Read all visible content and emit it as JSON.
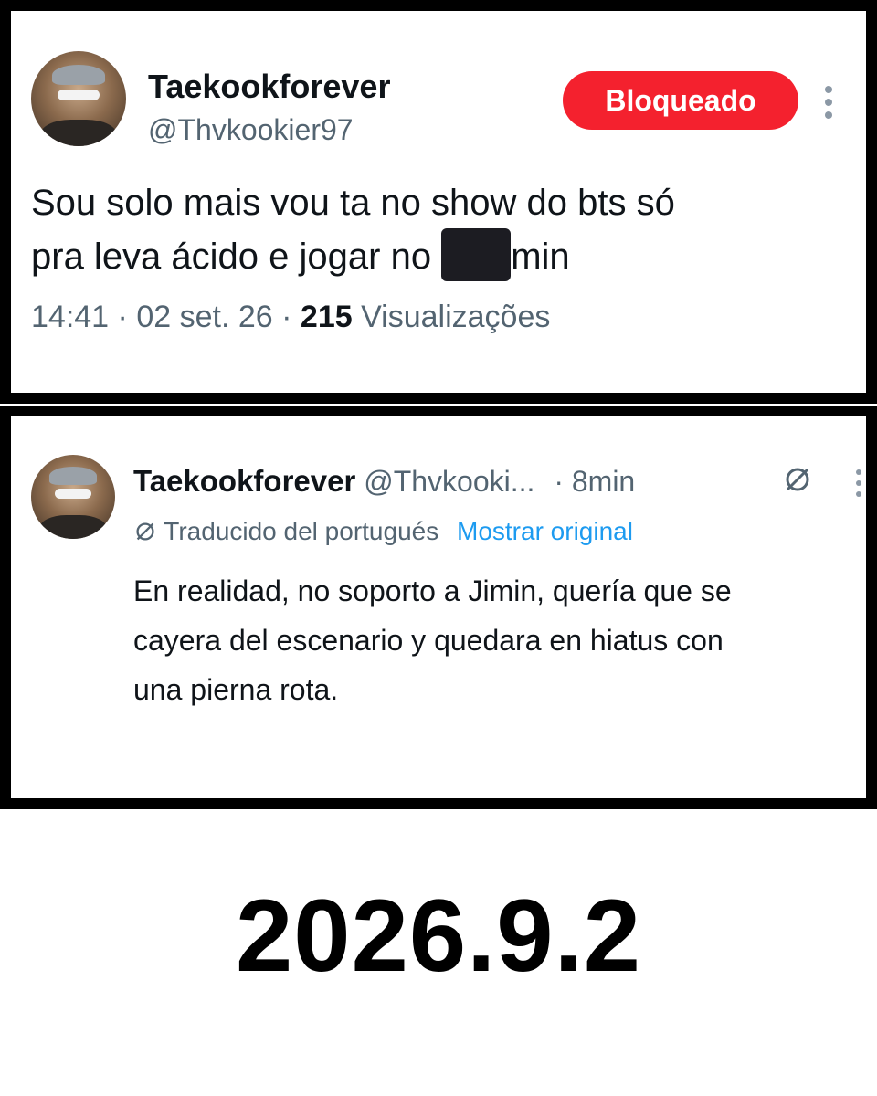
{
  "tweet_original": {
    "display_name": "Taekookforever",
    "handle": "@Thvkookier97",
    "blocked_label": "Bloqueado",
    "text_line1": "Sou solo mais vou ta no show do bts só",
    "text_line2_before": "pra leva ácido e jogar no ",
    "text_line2_after": "min",
    "time": "14:41",
    "date": "02 set. 26",
    "views_count": "215",
    "views_label": "Visualizações",
    "separator": "·"
  },
  "tweet_translated": {
    "display_name": "Taekookforever",
    "handle": "@Thvkooki...",
    "age": "· 8min",
    "translated_label": "Traducido del portugués",
    "show_original_label": "Mostrar original",
    "text_line1": "En realidad, no soporto a Jimin, quería que se",
    "text_line2": "cayera del escenario y quedara en hiatus con",
    "text_line3": "una pierna rota."
  },
  "caption": "2026.9.2",
  "colors": {
    "blocked_red": "#f4212e",
    "link_blue": "#1d9bf0",
    "muted_gray": "#536471"
  },
  "icons": [
    "more-vertical-icon",
    "translate-icon"
  ]
}
